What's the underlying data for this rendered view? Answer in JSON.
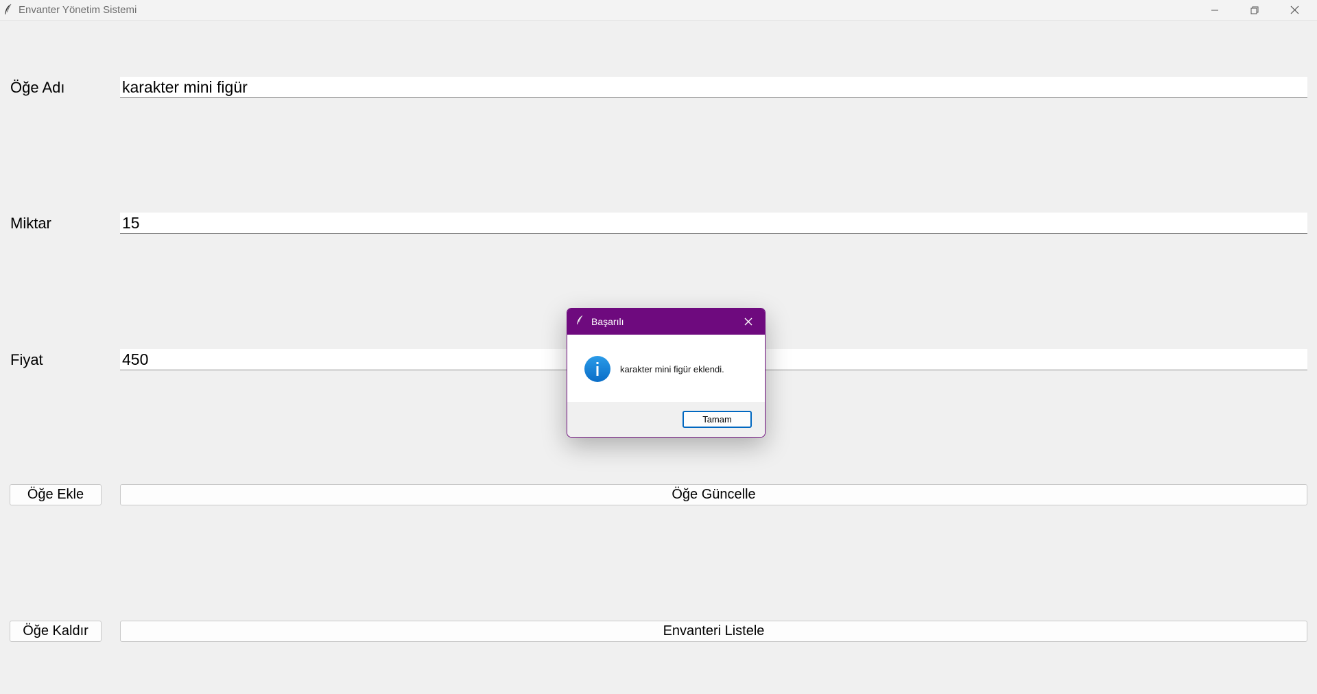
{
  "window": {
    "title": "Envanter Yönetim Sistemi"
  },
  "form": {
    "name_label": "Öğe Adı",
    "name_value": "karakter mini figür",
    "quantity_label": "Miktar",
    "quantity_value": "15",
    "price_label": "Fiyat",
    "price_value": "450"
  },
  "buttons": {
    "add": "Öğe Ekle",
    "update": "Öğe Güncelle",
    "remove": "Öğe Kaldır",
    "list": "Envanteri Listele"
  },
  "dialog": {
    "title": "Başarılı",
    "message": "karakter mini figür eklendi.",
    "ok_label": "Tamam",
    "icon": "info-icon",
    "accent_color": "#6e0a7e"
  }
}
